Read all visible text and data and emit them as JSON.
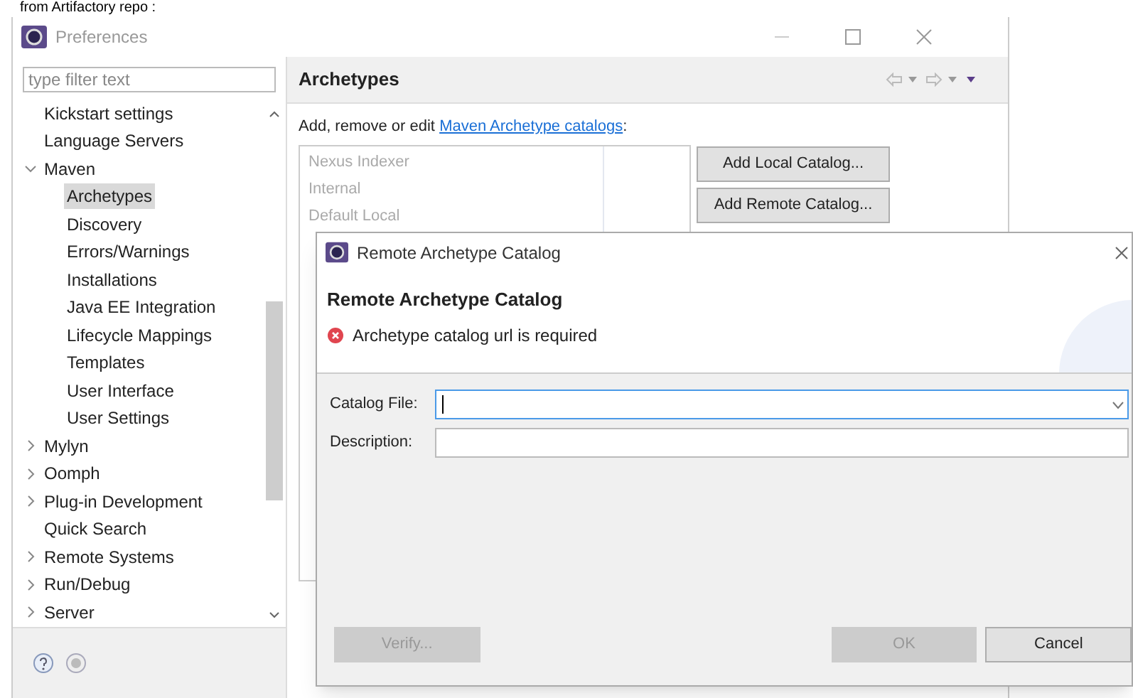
{
  "caption": "from Artifactory repo :",
  "window": {
    "title": "Preferences"
  },
  "filter": {
    "placeholder": "type filter text"
  },
  "tree": [
    {
      "label": "Kickstart settings",
      "kind": "page",
      "selected": false
    },
    {
      "label": "Language Servers",
      "kind": "page",
      "selected": false
    },
    {
      "label": "Maven",
      "kind": "group",
      "expanded": true,
      "selected": false,
      "children": [
        {
          "label": "Archetypes",
          "kind": "page",
          "selected": true
        },
        {
          "label": "Discovery",
          "kind": "page",
          "selected": false
        },
        {
          "label": "Errors/Warnings",
          "kind": "page",
          "selected": false
        },
        {
          "label": "Installations",
          "kind": "page",
          "selected": false
        },
        {
          "label": "Java EE Integration",
          "kind": "page",
          "selected": false
        },
        {
          "label": "Lifecycle Mappings",
          "kind": "page",
          "selected": false
        },
        {
          "label": "Templates",
          "kind": "page",
          "selected": false
        },
        {
          "label": "User Interface",
          "kind": "page",
          "selected": false
        },
        {
          "label": "User Settings",
          "kind": "page",
          "selected": false
        }
      ]
    },
    {
      "label": "Mylyn",
      "kind": "group",
      "expanded": false,
      "selected": false
    },
    {
      "label": "Oomph",
      "kind": "group",
      "expanded": false,
      "selected": false
    },
    {
      "label": "Plug-in Development",
      "kind": "group",
      "expanded": false,
      "selected": false
    },
    {
      "label": "Quick Search",
      "kind": "page",
      "selected": false
    },
    {
      "label": "Remote Systems",
      "kind": "group",
      "expanded": false,
      "selected": false
    },
    {
      "label": "Run/Debug",
      "kind": "group",
      "expanded": false,
      "selected": false
    },
    {
      "label": "Server",
      "kind": "group",
      "expanded": false,
      "selected": false
    }
  ],
  "page": {
    "title": "Archetypes",
    "intro": "Add, remove or edit ",
    "link": "Maven Archetype catalogs",
    "after_link": ":",
    "catalogs": [
      "Nexus Indexer",
      "Internal",
      "Default Local"
    ],
    "buttons": [
      "Add Local Catalog...",
      "Add Remote Catalog..."
    ]
  },
  "dialog": {
    "title": "Remote Archetype Catalog",
    "heading": "Remote Archetype Catalog",
    "error": "Archetype catalog url is required",
    "fields": [
      {
        "label": "Catalog File:",
        "kind": "combo",
        "focused": true
      },
      {
        "label": "Description:",
        "kind": "text",
        "focused": false
      }
    ],
    "buttons": [
      {
        "label": "Verify...",
        "disabled": true
      },
      {
        "label": "OK",
        "disabled": true
      },
      {
        "label": "Cancel",
        "disabled": false
      }
    ]
  }
}
